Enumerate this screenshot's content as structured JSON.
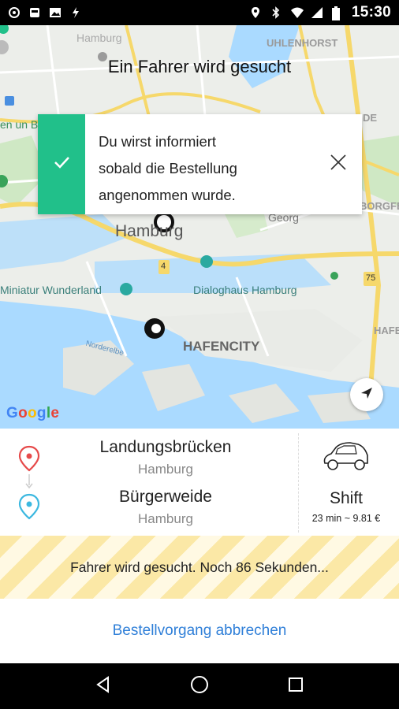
{
  "status_bar": {
    "time": "15:30",
    "left_icons": [
      "location-icon",
      "sim-icon",
      "image-icon",
      "data-icon"
    ],
    "right_icons": [
      "location-pin-icon",
      "bluetooth-icon",
      "wifi-icon",
      "signal-icon",
      "battery-icon"
    ]
  },
  "map": {
    "title": "Ein Fahrer wird gesucht",
    "labels": {
      "hamburg_top": "Hamburg",
      "uhlenhorst": "UHLENHORST",
      "hamburg_center": "Hamburg",
      "georg": "Georg",
      "miniatur": "Miniatur Wunderland",
      "dialoghaus": "Dialoghaus Hamburg",
      "hafencity": "HAFENCITY",
      "norderelbe": "Norderelbe",
      "road_4": "4",
      "road_75": "75",
      "left_partial": "en un B",
      "right_de": "DE",
      "right_borgfe": "BORGFE",
      "right_hafe": "HAFE"
    },
    "logo": "Google"
  },
  "notification": {
    "line1": "Du wirst informiert",
    "line2": "sobald die Bestellung",
    "line3": "angenommen wurde."
  },
  "route": {
    "pickup": {
      "name": "Landungsbrücken",
      "city": "Hamburg"
    },
    "dropoff": {
      "name": "Bürgerweide",
      "city": "Hamburg"
    },
    "vehicle": {
      "name": "Shift",
      "info": "23 min ~ 9.81 €"
    }
  },
  "searching": {
    "text": "Fahrer wird gesucht. Noch 86 Sekunden..."
  },
  "cancel": {
    "label": "Bestellvorgang abbrechen"
  },
  "colors": {
    "accent_green": "#21c08a",
    "pickup_red": "#e64a4a",
    "dropoff_blue": "#3cb8e0",
    "link_blue": "#2f7fd8",
    "stripe_yellow": "#fbe8a6"
  }
}
